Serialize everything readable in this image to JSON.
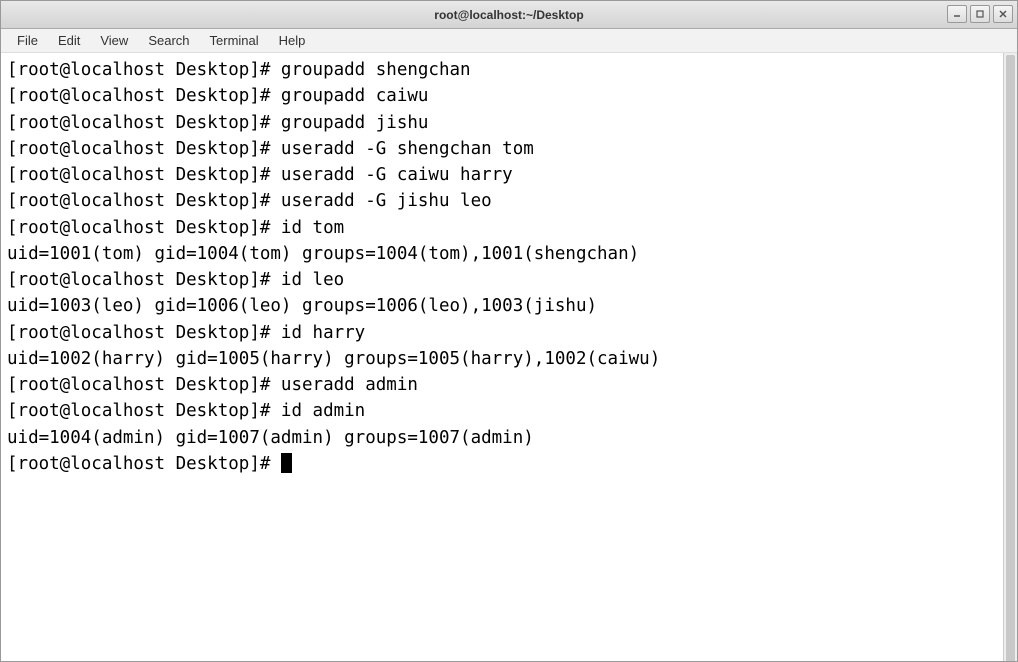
{
  "window": {
    "title": "root@localhost:~/Desktop"
  },
  "menubar": {
    "items": [
      "File",
      "Edit",
      "View",
      "Search",
      "Terminal",
      "Help"
    ]
  },
  "prompt": "[root@localhost Desktop]# ",
  "lines": [
    {
      "type": "cmd",
      "text": "groupadd shengchan"
    },
    {
      "type": "cmd",
      "text": "groupadd caiwu"
    },
    {
      "type": "cmd",
      "text": "groupadd jishu"
    },
    {
      "type": "cmd",
      "text": "useradd -G shengchan tom"
    },
    {
      "type": "cmd",
      "text": "useradd -G caiwu harry"
    },
    {
      "type": "cmd",
      "text": "useradd -G jishu leo"
    },
    {
      "type": "cmd",
      "text": "id tom"
    },
    {
      "type": "out",
      "text": "uid=1001(tom) gid=1004(tom) groups=1004(tom),1001(shengchan)"
    },
    {
      "type": "cmd",
      "text": "id leo"
    },
    {
      "type": "out",
      "text": "uid=1003(leo) gid=1006(leo) groups=1006(leo),1003(jishu)"
    },
    {
      "type": "cmd",
      "text": "id harry"
    },
    {
      "type": "out",
      "text": "uid=1002(harry) gid=1005(harry) groups=1005(harry),1002(caiwu)"
    },
    {
      "type": "cmd",
      "text": "useradd admin"
    },
    {
      "type": "cmd",
      "text": "id admin"
    },
    {
      "type": "out",
      "text": "uid=1004(admin) gid=1007(admin) groups=1007(admin)"
    },
    {
      "type": "cursor",
      "text": ""
    }
  ]
}
